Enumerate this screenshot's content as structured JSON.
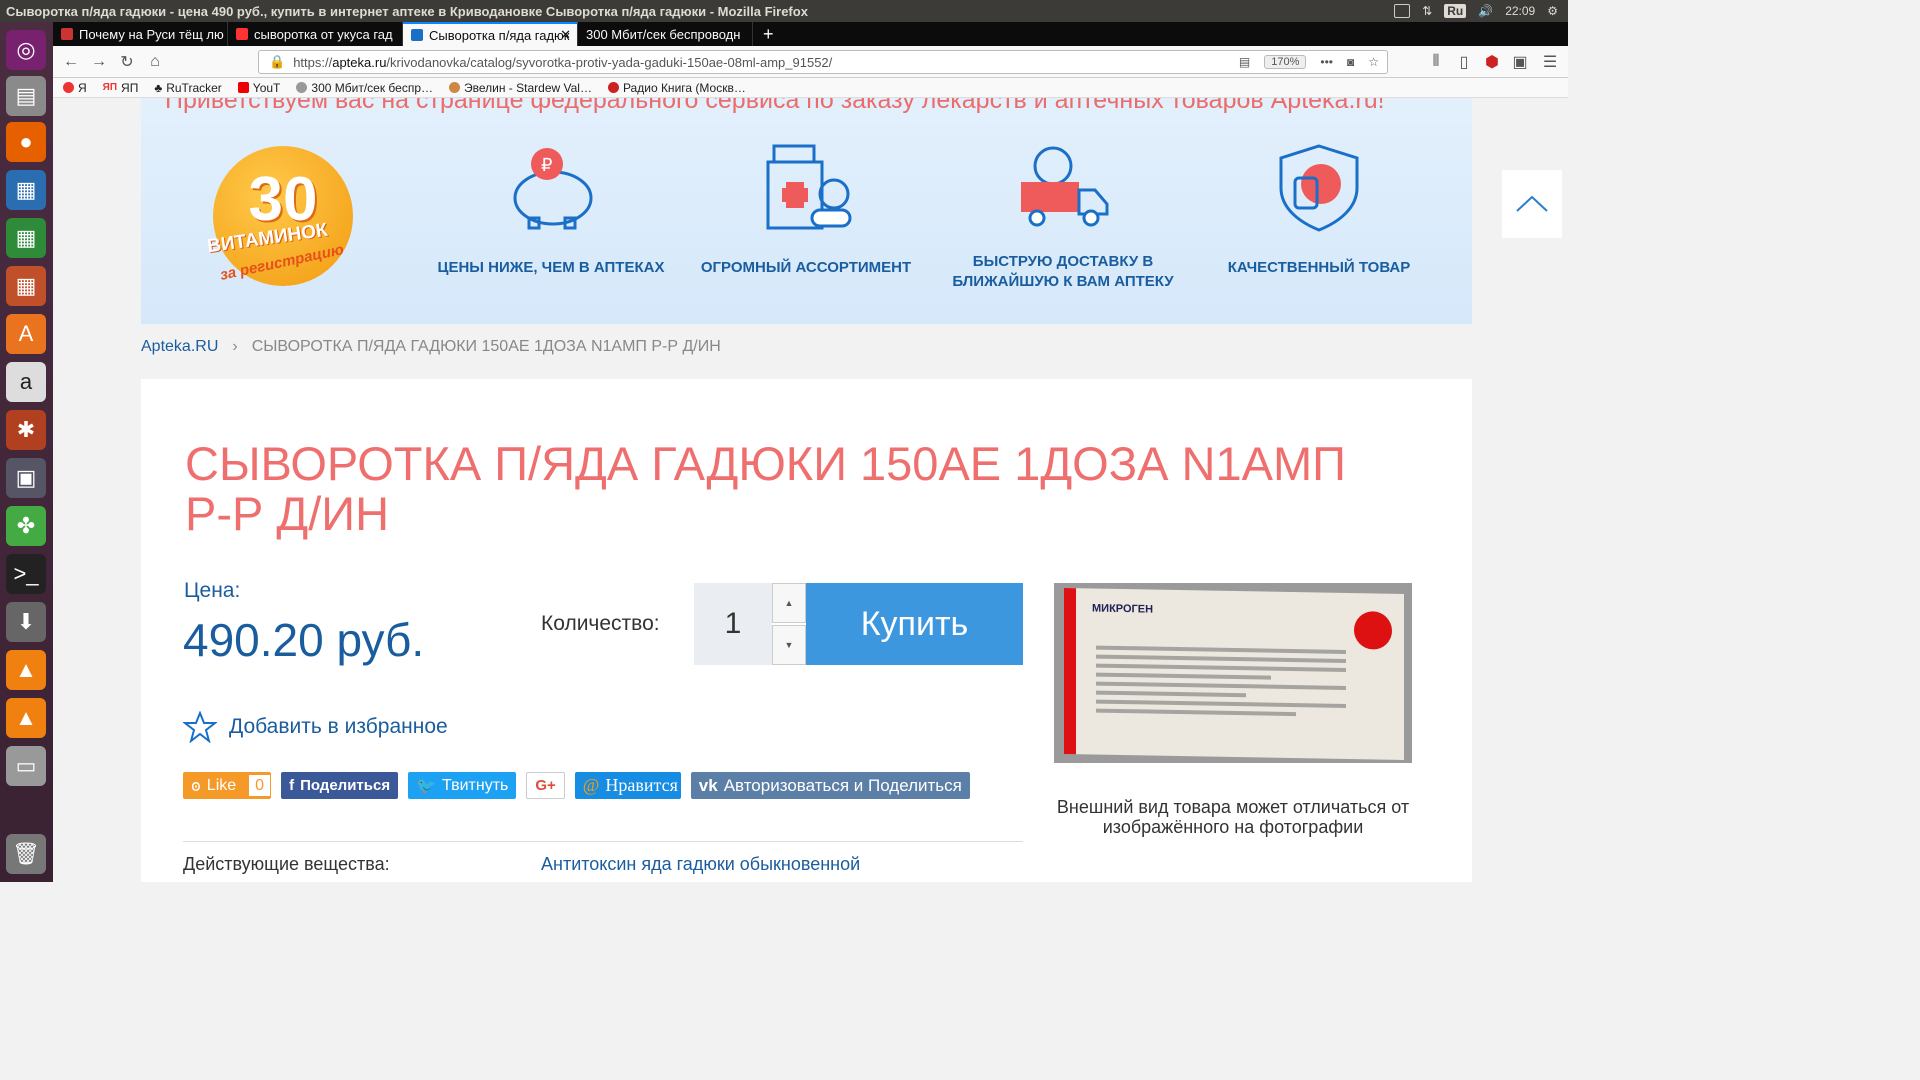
{
  "window_title": "Сыворотка п/яда гадюки - цена 490 руб., купить в интернет аптеке в Криводановке Сыворотка п/яда гадюки - Mozilla Firefox",
  "tray": {
    "keyboard": "Ru",
    "time": "22:09"
  },
  "tabs": [
    {
      "label": "Почему на Руси тёщ лю",
      "active": false
    },
    {
      "label": "сыворотка от укуса гад",
      "active": false
    },
    {
      "label": "Сыворотка п/яда гадюк",
      "active": true
    },
    {
      "label": "300 Мбит/сек беспроводн",
      "active": false
    }
  ],
  "url": {
    "scheme": "https://",
    "host": "apteka.ru",
    "path": "/krivodanovka/catalog/syvorotka-protiv-yada-gaduki-150ae-08ml-amp_91552/",
    "zoom": "170%"
  },
  "bookmarks": [
    "Я",
    "ЯП",
    "RuTracker",
    "YouT",
    "300 Мбит/сек беспр…",
    "Эвелин - Stardew Val…",
    "Радио Книга (Москв…"
  ],
  "banner": {
    "greeting": "Приветствуем вас на странице федерального сервиса по заказу лекарств и аптечных товаров Apteka.ru!",
    "promo_number": "30",
    "promo_word": "ВИТАМИНОК",
    "promo_sub": "за регистрацию",
    "features": [
      "ЦЕНЫ НИЖЕ, ЧЕМ В АПТЕКАХ",
      "ОГРОМНЫЙ АССОРТИМЕНТ",
      "БЫСТРУЮ ДОСТАВКУ В БЛИЖАЙШУЮ К ВАМ АПТЕКУ",
      "КАЧЕСТВЕННЫЙ ТОВАР"
    ]
  },
  "breadcrumb": {
    "home": "Apteka.RU",
    "sep": "›",
    "current": "СЫВОРОТКА П/ЯДА ГАДЮКИ 150АЕ 1ДОЗА N1АМП Р-Р Д/ИН"
  },
  "product": {
    "title": "СЫВОРОТКА П/ЯДА ГАДЮКИ 150АЕ 1ДОЗА N1АМП Р-Р Д/ИН",
    "price_label": "Цена:",
    "price": "490.20 руб.",
    "qty_label": "Количество:",
    "qty": "1",
    "buy": "Купить",
    "favorite": "Добавить в избранное",
    "active_label": "Действующие вещества:",
    "active_value": "Антитоксин яда гадюки обыкновенной",
    "photo_caption": "Внешний вид товара может отличаться от изображённого на фотографии",
    "box_brand": "МИКРОГЕН"
  },
  "social": {
    "ok": "Like",
    "ok_count": "0",
    "fb": "Поделиться",
    "tw": "Твитнуть",
    "gp": "G+",
    "mm": "Нравится",
    "vk": "Авторизоваться и Поделиться"
  },
  "colors": {
    "accent": "#3c97de",
    "title": "#ef6f6f",
    "link": "#1a5d9f"
  }
}
